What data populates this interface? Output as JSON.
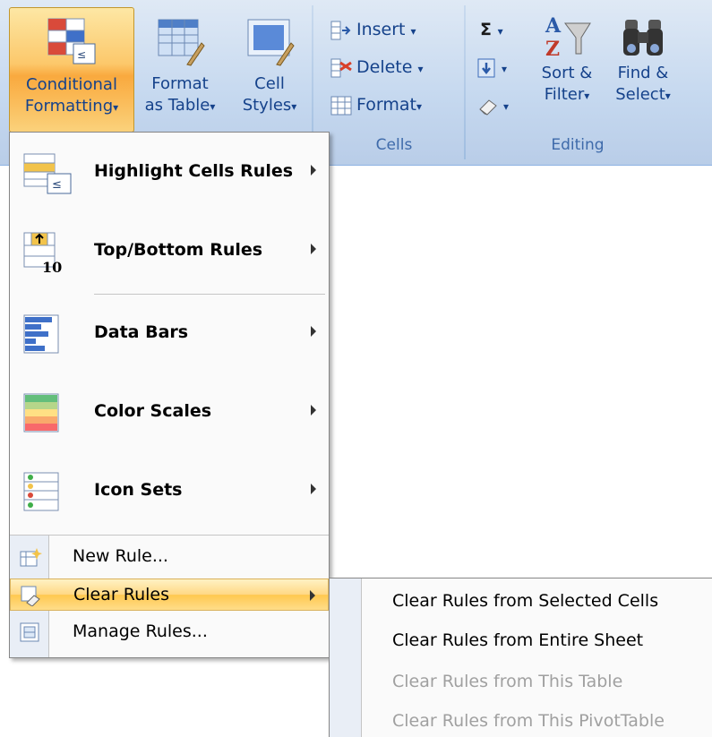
{
  "ribbon": {
    "conditional_formatting": {
      "line1": "Conditional",
      "line2": "Formatting"
    },
    "format_as_table": {
      "line1": "Format",
      "line2": "as Table"
    },
    "cell_styles": {
      "line1": "Cell",
      "line2": "Styles"
    },
    "cells_group": {
      "insert": "Insert",
      "delete": "Delete",
      "format": "Format",
      "label": "Cells"
    },
    "editing_group": {
      "sum_symbol": "Σ",
      "sort_filter": {
        "line1": "Sort &",
        "line2": "Filter"
      },
      "find_select": {
        "line1": "Find &",
        "line2": "Select"
      },
      "label": "Editing"
    },
    "dropdown_glyph": "▾"
  },
  "menu": {
    "items": [
      {
        "label": "Highlight Cells Rules"
      },
      {
        "label": "Top/Bottom Rules"
      },
      {
        "label": "Data Bars"
      },
      {
        "label": "Color Scales"
      },
      {
        "label": "Icon Sets"
      }
    ],
    "new_rule": "New Rule...",
    "clear_rules": "Clear Rules",
    "manage_rules": "Manage Rules..."
  },
  "submenu": {
    "items": [
      {
        "label": "Clear Rules from Selected Cells",
        "enabled": true
      },
      {
        "label": "Clear Rules from Entire Sheet",
        "enabled": true
      },
      {
        "label": "Clear Rules from This Table",
        "enabled": false
      },
      {
        "label": "Clear Rules from This PivotTable",
        "enabled": false
      }
    ]
  },
  "colors": {
    "ribbon_text": "#15428b",
    "highlight": "#ffc84f",
    "disabled_text": "#a0a0a0"
  }
}
